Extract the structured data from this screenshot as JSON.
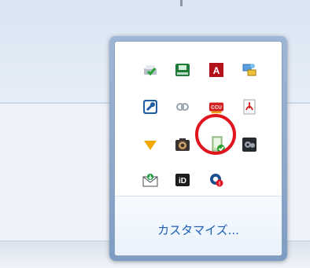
{
  "flyout": {
    "customize_label": "カスタマイズ...",
    "icons": [
      {
        "name": "printer-check-icon"
      },
      {
        "name": "green-disk-icon"
      },
      {
        "name": "adobe-acrobat-icon"
      },
      {
        "name": "network-icon"
      },
      {
        "name": "tool-settings-icon"
      },
      {
        "name": "creative-cloud-icon"
      },
      {
        "name": "ccu-icon"
      },
      {
        "name": "pdf-icon"
      },
      {
        "name": "yellow-chevron-icon"
      },
      {
        "name": "camera-icon"
      },
      {
        "name": "security-shield-check-icon"
      },
      {
        "name": "gears-icon"
      },
      {
        "name": "mail-download-icon"
      },
      {
        "name": "id-icon"
      },
      {
        "name": "dropbox-alert-icon"
      }
    ],
    "tiles": {
      "adobe": "A",
      "ccu": "CCU",
      "id": "iD",
      "alert_mark": "!"
    },
    "colors": {
      "highlight_ring": "#e0151e",
      "link": "#1d5fb6"
    }
  }
}
